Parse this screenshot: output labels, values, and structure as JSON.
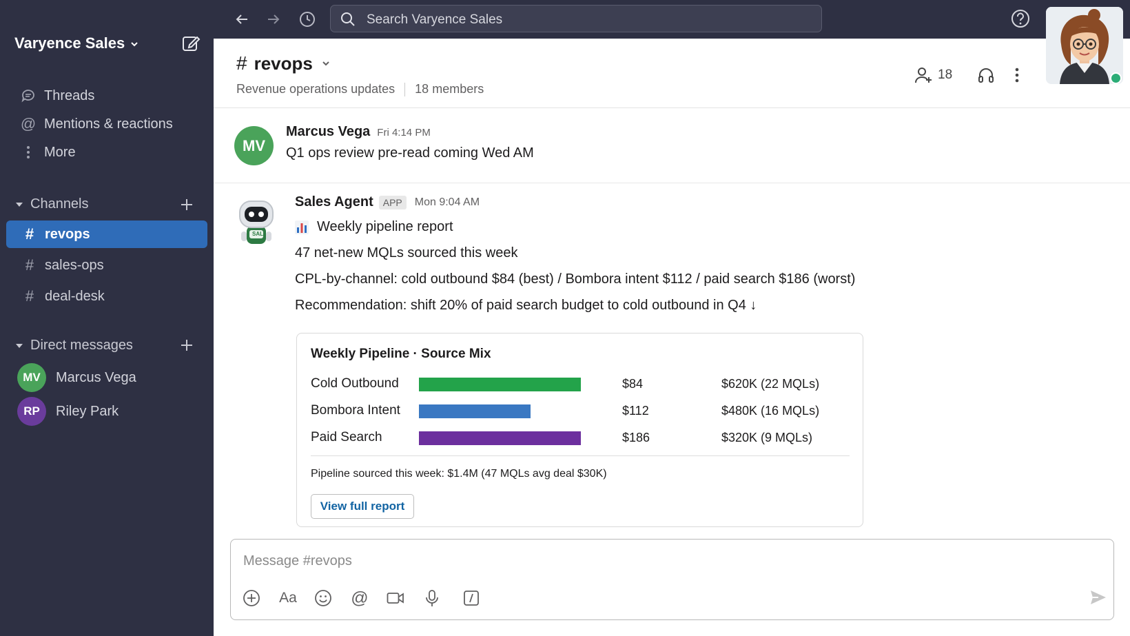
{
  "workspace": {
    "name": "Varyence Sales"
  },
  "search": {
    "placeholder": "Search Varyence Sales"
  },
  "sidebar": {
    "nav": [
      {
        "label": "Threads",
        "icon": "threads-icon"
      },
      {
        "label": "Mentions & reactions",
        "icon": "at-icon"
      },
      {
        "label": "More",
        "icon": "more-vertical-icon"
      }
    ],
    "channels_header": "Channels",
    "channels": [
      {
        "label": "revops",
        "active": true
      },
      {
        "label": "sales-ops",
        "active": false
      },
      {
        "label": "deal-desk",
        "active": false
      }
    ],
    "dm_header": "Direct messages",
    "dms": [
      {
        "initials": "MV",
        "label": "Marcus Vega",
        "color": "#4aa35a"
      },
      {
        "initials": "RP",
        "label": "Riley Park",
        "color": "#6a3c9c"
      }
    ]
  },
  "channel": {
    "name": "revops",
    "description": "Revenue operations updates",
    "members_text": "18 members",
    "member_count": "18"
  },
  "messages": [
    {
      "initials": "MV",
      "author": "Marcus Vega",
      "time": "Fri 4:14 PM",
      "text": "Q1 ops review pre-read coming Wed AM",
      "avatar_color": "#4aa35a"
    },
    {
      "author": "Sales Agent",
      "badge": "APP",
      "time": "Mon 9:04 AM",
      "lines": [
        "Weekly pipeline report",
        "47 net-new MQLs sourced this week",
        "CPL-by-channel: cold outbound $84 (best) / Bombora intent $112 / paid search $186 (worst)",
        "Recommendation: shift 20% of paid search budget to cold outbound in Q4 ↓"
      ],
      "avatar_badge": "SAL"
    }
  ],
  "card": {
    "title": "Weekly Pipeline · Source Mix",
    "rows": [
      {
        "label": "Cold Outbound",
        "cpl": "$84",
        "pipeline": "$620K  (22 MQLs)",
        "color": "#23a34a",
        "bar_level": 1.0
      },
      {
        "label": "Bombora Intent",
        "cpl": "$112",
        "pipeline": "$480K  (16 MQLs)",
        "color": "#3a78c2",
        "bar_level": 0.69
      },
      {
        "label": "Paid Search",
        "cpl": "$186",
        "pipeline": "$320K  (9 MQLs)",
        "color": "#6c2f9e",
        "bar_level": 1.0
      }
    ],
    "footer": "Pipeline sourced this week: $1.4M (47 MQLs avg deal $30K)",
    "button": "View full report"
  },
  "composer": {
    "placeholder": "Message #revops"
  },
  "colors": {
    "sidebar_bg": "#2e3043",
    "active_channel": "#2f6cb8",
    "link": "#1264a3",
    "online": "#2bac76"
  }
}
